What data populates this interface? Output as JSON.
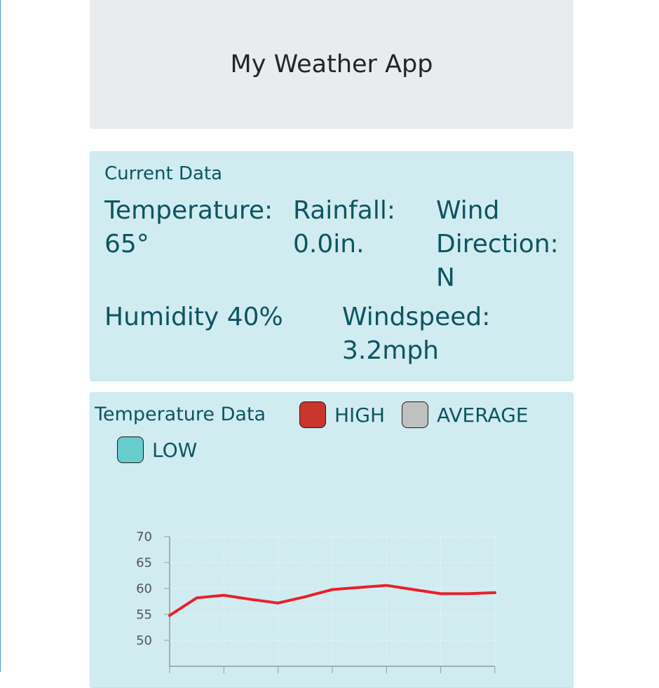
{
  "header": {
    "title": "My Weather App"
  },
  "current": {
    "title": "Current Data",
    "temperature": {
      "label": "Temperature:",
      "value": "65°"
    },
    "rainfall": {
      "label": "Rainfall:",
      "value": "0.0in."
    },
    "wind_direction": {
      "label_line1": "Wind",
      "label_line2": "Direction:",
      "value": "N"
    },
    "humidity": {
      "label": "Humidity",
      "value": "40%"
    },
    "windspeed": {
      "label": "Windspeed:",
      "value": "3.2mph"
    }
  },
  "temperature_chart": {
    "title": "Temperature Data",
    "legend": [
      {
        "label": "HIGH",
        "color": "#c9362e"
      },
      {
        "label": "AVERAGE",
        "color": "#c0c0c0"
      },
      {
        "label": "LOW",
        "color": "#66cccc"
      }
    ]
  },
  "chart_data": {
    "type": "line",
    "title": "Temperature Data",
    "x": [
      0,
      1,
      2,
      3,
      4,
      5,
      6,
      7,
      8,
      9,
      10,
      11,
      12
    ],
    "series": [
      {
        "name": "HIGH",
        "color": "#e8202a",
        "values": [
          54.8,
          58.2,
          58.7,
          57.9,
          57.2,
          58.4,
          59.8,
          60.2,
          60.6,
          59.8,
          59.0,
          59.0,
          59.2
        ]
      }
    ],
    "yticks": [
      50,
      55,
      60,
      65,
      70
    ],
    "ylim": [
      45,
      70
    ],
    "grid": true
  }
}
